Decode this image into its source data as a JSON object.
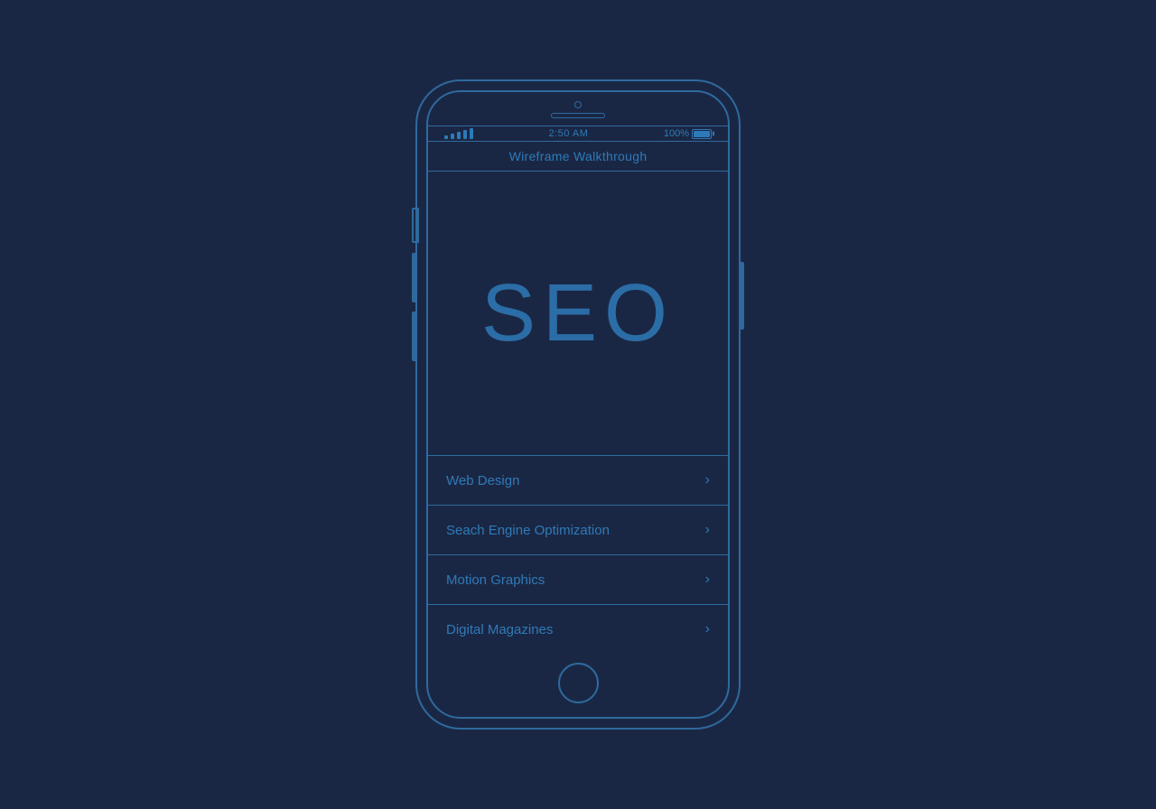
{
  "background": {
    "color": "#1a2744"
  },
  "phone": {
    "status_bar": {
      "signal": "•••••",
      "time": "2:50 AM",
      "battery_percent": "100%"
    },
    "nav_bar": {
      "title": "Wireframe Walkthrough"
    },
    "hero": {
      "text": "SEO"
    },
    "menu_items": [
      {
        "label": "Web Design",
        "chevron": "›"
      },
      {
        "label": "Seach Engine Optimization",
        "chevron": "›"
      },
      {
        "label": "Motion Graphics",
        "chevron": "›"
      },
      {
        "label": "Digital Magazines",
        "chevron": "›"
      }
    ]
  }
}
